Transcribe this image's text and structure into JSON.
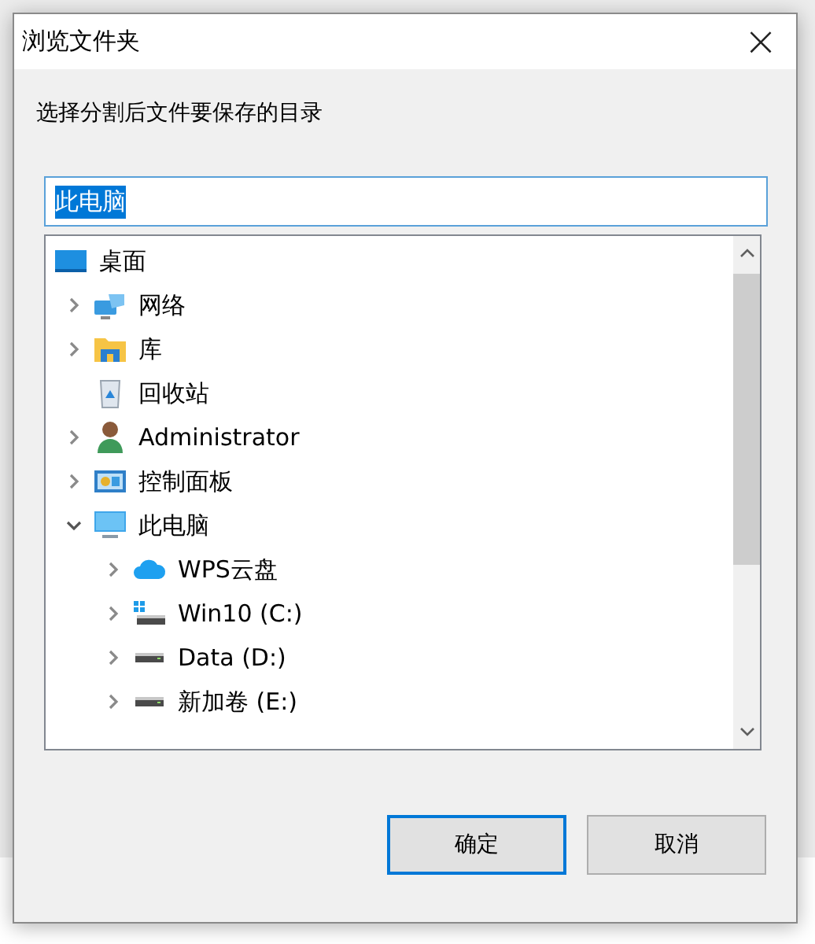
{
  "window": {
    "title": "浏览文件夹",
    "close": "×"
  },
  "prompt": "选择分割后文件要保存的目录",
  "folder_field": {
    "value": "此电脑",
    "selected": true
  },
  "tree": [
    {
      "label": "桌面",
      "kind": "desktop",
      "children": [
        {
          "label": "网络",
          "kind": "network",
          "expandable": true,
          "expanded": false
        },
        {
          "label": "库",
          "kind": "library",
          "expandable": true,
          "expanded": false
        },
        {
          "label": "回收站",
          "kind": "recycle"
        },
        {
          "label": "Administrator",
          "kind": "user",
          "expandable": true,
          "expanded": false
        },
        {
          "label": "控制面板",
          "kind": "control",
          "expandable": true,
          "expanded": false
        },
        {
          "label": "此电脑",
          "kind": "computer",
          "expandable": true,
          "expanded": true,
          "children": [
            {
              "label": "WPS云盘",
              "kind": "cloud",
              "expandable": true,
              "expanded": false
            },
            {
              "label": "Win10 (C:)",
              "kind": "sysdrive",
              "expandable": true,
              "expanded": false
            },
            {
              "label": "Data (D:)",
              "kind": "drive",
              "expandable": true,
              "expanded": false
            },
            {
              "label": "新加卷 (E:)",
              "kind": "drive",
              "expandable": true,
              "expanded": false
            }
          ]
        }
      ]
    }
  ],
  "buttons": [
    {
      "label": "确定",
      "default": true
    },
    {
      "label": "取消",
      "default": false
    }
  ]
}
